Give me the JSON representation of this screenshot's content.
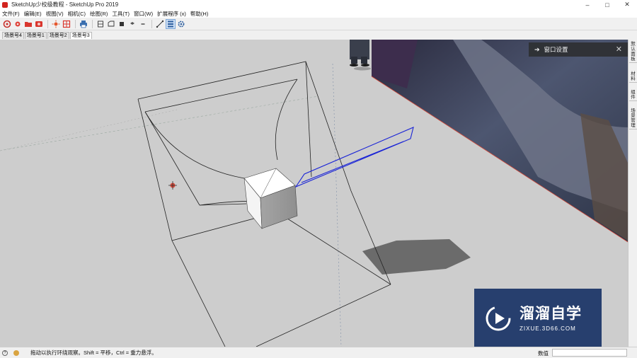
{
  "window": {
    "title": "SketchUp少校级教程 - SketchUp Pro 2019",
    "controls": {
      "minimize": "–",
      "maximize": "□",
      "close": "✕"
    }
  },
  "menu": {
    "items": [
      {
        "label": "文件(F)"
      },
      {
        "label": "编辑(E)"
      },
      {
        "label": "视图(V)"
      },
      {
        "label": "相机(C)"
      },
      {
        "label": "绘图(R)"
      },
      {
        "label": "工具(T)"
      },
      {
        "label": "窗口(W)"
      },
      {
        "label": "扩展程序 (x)"
      },
      {
        "label": "帮助(H)"
      }
    ]
  },
  "toolbar": {
    "buttons": [
      {
        "icon": "solid-tools-icon"
      },
      {
        "icon": "gear-red-icon"
      },
      {
        "icon": "folder-red-icon"
      },
      {
        "icon": "camera-red-icon"
      },
      {
        "icon": "sun-shadow-icon"
      },
      {
        "icon": "grid-section-icon"
      },
      {
        "icon": "printer-icon"
      },
      {
        "icon": "view-front-icon"
      },
      {
        "icon": "view-back-icon"
      },
      {
        "icon": "view-solid-icon"
      },
      {
        "icon": "view-top-icon"
      },
      {
        "icon": "view-iso-icon"
      },
      {
        "icon": "axes-icon"
      },
      {
        "icon": "layers-panel-icon"
      },
      {
        "icon": "settings-gear-icon"
      }
    ]
  },
  "scene_tabs": [
    {
      "label": "场景号4",
      "active": false
    },
    {
      "label": "场景号1",
      "active": false
    },
    {
      "label": "场景号2",
      "active": false
    },
    {
      "label": "场景号3",
      "active": true
    }
  ],
  "right_tray": {
    "tabs": [
      {
        "label": "默认面板"
      },
      {
        "label": "材料"
      },
      {
        "label": "组件"
      },
      {
        "label": "场景管理"
      }
    ]
  },
  "panel": {
    "title": "窗口设置",
    "arrow_icon": "arrow-right-icon",
    "close_icon": "close-icon"
  },
  "watermark": {
    "title": "溜溜自学",
    "url": "ZIXUE.3D66.COM"
  },
  "status": {
    "hint": "拖动以执行环绕观察。Shift = 平移，Ctrl = 重力悬浮。",
    "measure_label": "数值",
    "measure_value": ""
  },
  "colors": {
    "viewport_bg": "#cdcdcd",
    "selection_blue": "#1a24d6",
    "watermark_bg": "#273f6e",
    "panel_bg": "#2e3033",
    "shadow": "#6b6b6b"
  }
}
